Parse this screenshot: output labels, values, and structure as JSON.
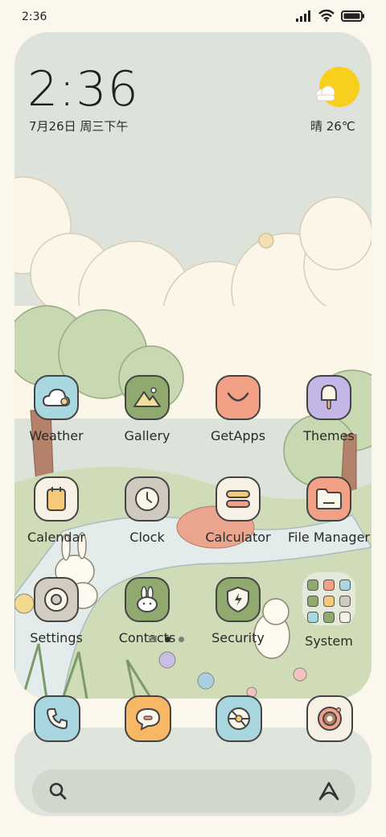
{
  "status_bar": {
    "time": "2:36",
    "icons": [
      "signal-icon",
      "wifi-icon",
      "battery-icon"
    ]
  },
  "clock_widget": {
    "time": "2:36",
    "date": "7月26日 周三下午"
  },
  "weather_widget": {
    "icon": "sun-cloud-icon",
    "summary": "晴 26℃"
  },
  "apps": [
    {
      "label": "Weather",
      "icon": "weather-icon",
      "color": "#a8d7df"
    },
    {
      "label": "Gallery",
      "icon": "mountain-icon",
      "color": "#8fa96f"
    },
    {
      "label": "GetApps",
      "icon": "smile-bag-icon",
      "color": "#f2a187"
    },
    {
      "label": "Themes",
      "icon": "popsicle-icon",
      "color": "#c4b6e6"
    },
    {
      "label": "Calendar",
      "icon": "calendar-icon",
      "color": "#f6f1e4"
    },
    {
      "label": "Clock",
      "icon": "clock-icon",
      "color": "#cfc9c0"
    },
    {
      "label": "Calculator",
      "icon": "calculator-icon",
      "color": "#f6f1e4"
    },
    {
      "label": "File Manager",
      "icon": "folder-icon",
      "color": "#f2a187"
    },
    {
      "label": "Settings",
      "icon": "gear-icon",
      "color": "#d2ccc2"
    },
    {
      "label": "Contacts",
      "icon": "bunny-icon",
      "color": "#8fa96f"
    },
    {
      "label": "Security",
      "icon": "shield-icon",
      "color": "#8fa96f"
    },
    {
      "label": "System",
      "icon": "folder-grid-icon",
      "color": "#e8ebe2"
    }
  ],
  "dock": [
    {
      "name": "phone",
      "icon": "phone-icon",
      "color": "#a8d7df"
    },
    {
      "name": "messages",
      "icon": "message-icon",
      "color": "#f7b865"
    },
    {
      "name": "browser",
      "icon": "browser-icon",
      "color": "#a8d7df"
    },
    {
      "name": "camera",
      "icon": "camera-icon",
      "color": "#f6f1e4"
    }
  ],
  "page_indicator": {
    "pages": 3,
    "current": 1
  },
  "search": {
    "icon": "search-icon",
    "assistant_icon": "assistant-icon"
  }
}
